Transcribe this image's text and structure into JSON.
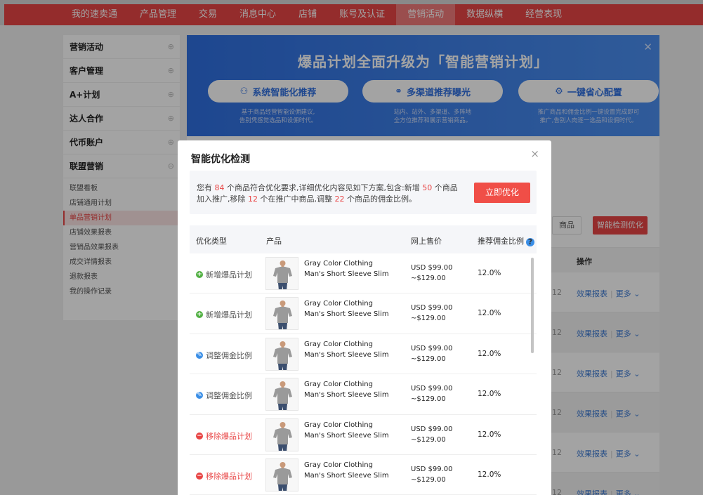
{
  "nav": [
    "我的速卖通",
    "产品管理",
    "交易",
    "消息中心",
    "店铺",
    "账号及认证",
    "营销活动",
    "数据纵横",
    "经营表现"
  ],
  "nav_selected": 6,
  "sidebar": {
    "groups": [
      {
        "label": "营销活动",
        "expand": "⊕"
      },
      {
        "label": "客户管理",
        "expand": "⊕"
      },
      {
        "label": "A+计划",
        "expand": "⊕"
      },
      {
        "label": "达人合作",
        "expand": "⊕"
      },
      {
        "label": "代币账户",
        "expand": "⊕"
      },
      {
        "label": "联盟营销",
        "expand": "⊖"
      }
    ],
    "items": [
      "联盟看板",
      "店铺通用计划",
      "单品营销计划",
      "店铺效果报表",
      "营销品效果报表",
      "成交详情报表",
      "退款报表",
      "我的操作记录"
    ],
    "selected": 2
  },
  "banner": {
    "title": "爆品计划全面升级为「智能营销计划」",
    "features": [
      {
        "label": "系统智能化推荐",
        "icon": "people-icon",
        "desc1": "基于商品经营智能设佣建议,",
        "desc2": "告别凭感觉选品和设佣时代。"
      },
      {
        "label": "多渠道推荐曝光",
        "icon": "network-icon",
        "desc1": "站内、站外、多渠道、多阵地",
        "desc2": "全方位推荐和展示营销商品。"
      },
      {
        "label": "一键省心配置",
        "icon": "config-icon",
        "desc1": "推广商品和佣金比例一键设置完成即可",
        "desc2": "推广,告别人肉逐一选品和设佣时代。"
      }
    ]
  },
  "background": {
    "btn_goods": "商品",
    "btn_detect": "智能检测优化",
    "col_op": "操作",
    "row_num": "12",
    "link_report": "效果报表",
    "link_more": "更多 ⌄"
  },
  "modal": {
    "title": "智能优化检测",
    "close": "×",
    "notice": {
      "p1": "您有 ",
      "n1": "84",
      "p2": " 个商品符合优化要求,详细优化内容见如下方案,包含:新增 ",
      "n2": "50",
      "p3": " 个商品加入推广,移除 ",
      "n3": "12",
      "p4": " 个在推广中商品,调整 ",
      "n4": "22",
      "p5": " 个商品的佣金比例。"
    },
    "optimize_button": "立即优化",
    "columns": {
      "type": "优化类型",
      "product": "产品",
      "price": "网上售价",
      "commission": "推荐佣金比例",
      "help": "?"
    },
    "rows": [
      {
        "type": "新增爆品计划",
        "kind": "add",
        "sym": "+",
        "name": "Gray Color Clothing Man's Short Sleeve Slim",
        "price1": "USD $99.00",
        "price2": "~$129.00",
        "pct": "12.0%"
      },
      {
        "type": "新增爆品计划",
        "kind": "add",
        "sym": "+",
        "name": "Gray Color Clothing Man's Short Sleeve Slim",
        "price1": "USD $99.00",
        "price2": "~$129.00",
        "pct": "12.0%"
      },
      {
        "type": "调整佣金比例",
        "kind": "adj",
        "sym": "✎",
        "name": "Gray Color Clothing Man's Short Sleeve Slim",
        "price1": "USD $99.00",
        "price2": "~$129.00",
        "pct": "12.0%"
      },
      {
        "type": "调整佣金比例",
        "kind": "adj",
        "sym": "✎",
        "name": "Gray Color Clothing Man's Short Sleeve Slim",
        "price1": "USD $99.00",
        "price2": "~$129.00",
        "pct": "12.0%"
      },
      {
        "type": "移除爆品计划",
        "kind": "rm",
        "sym": "−",
        "name": "Gray Color Clothing Man's Short Sleeve Slim",
        "price1": "USD $99.00",
        "price2": "~$129.00",
        "pct": "12.0%"
      },
      {
        "type": "移除爆品计划",
        "kind": "rm",
        "sym": "−",
        "name": "Gray Color Clothing Man's Short Sleeve Slim",
        "price1": "USD $99.00",
        "price2": "~$129.00",
        "pct": "12.0%"
      }
    ]
  },
  "colors": {
    "brand_red": "#e84545",
    "banner_blue": "#2f6fe0",
    "link_blue": "#3a79d4",
    "add_green": "#52b043",
    "adjust_blue": "#3a8ee6"
  }
}
